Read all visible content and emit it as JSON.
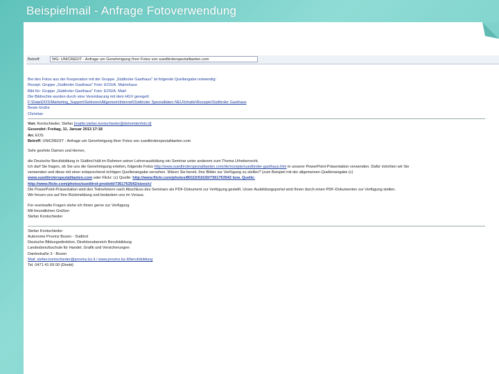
{
  "slide_title": "Beispielmail - Anfrage Fotoverwendung",
  "mail": {
    "subject_label": "Betreff:",
    "subject_value": "WG: UNICREDIT - Anfrage um Genehmigung Ihrer Fotos von suedtirolerspezialitaeten.com",
    "intro_lines": [
      "Bei den Fotos aus der Kooperation mit der Gruppe „Südtiroler Gasthaus\" ist folgende Quellangabe notwendig:",
      "Rezept: Gruppe „Südtiroler Gasthaus\" Foto: EOS/A. Mairinhaus",
      "Bild für: Gruppe „Südtiroler Gasthaus\" Foto: EOS/A. Mairl",
      "Die Bildrechte wurden durch eine Vereinbarung mit dem HGV geregelt:"
    ],
    "path_line": "F:\\Data\\DOS\\Marketing_Support\\Sektoren\\Allgemein\\Internet\\Südtiroler Spezialitäten NEU\\Inhalte\\Rezepte\\Südtiroler Gasthaus",
    "greeting": "Beste Grüße",
    "sender_first": "Christian",
    "header_fields": [
      {
        "label": "Von:",
        "value": "Kontschieder, Stefan",
        "link": "[mailto:stefan.kontschieder@dolomitenfoto.it]"
      },
      {
        "label": "Gesendet:",
        "value": "Freitag, 11. Januar 2013 17:18",
        "link": ""
      },
      {
        "label": "An:",
        "value": "EOS",
        "link": ""
      },
      {
        "label": "Betreff:",
        "value": "UNICREDIT - Anfrage um Genehmigung Ihrer Fotos von suedtirolerspezialitaeten.com",
        "link": ""
      }
    ],
    "salutation": "Sehr geehrte Damen und Herren,",
    "paragraph_lines": [
      "die Deutsche Berufsbildung in Südtirol hält im Rahmen seiner Lehrerausbildung ein Seminar unter anderem zum Thema Urheberrecht.",
      "Ich darf Sie fragen, ob Sie uns die Genehmigung erteilen, folgende Fotos",
      "verwenden und diese mit einer entsprechend richtigen Quellenangabe versehen. Wären Sie bereit, Ihre Bilder zur Verfügung zu stellen? (zum Beispiel mit der allgemeinen Quellenangabe (c)"
    ],
    "paragraph_link_1": "http://www.suedtirolerspezialitaeten.com/de/rezepte/suedtiroler-gasthaus.htm",
    "paragraph_tail_1": "in unserer PowerPoint-Präsentation verwenden. Dafür möchten wir Sie",
    "url_line_1": "www.suedtirolerspezialitaeten.com",
    "url_tail_1": "oder Flickr: (c) Quelle:",
    "url_line_2": "http://www.flickr.com/photos/80115/51630/7361763542 bzw. Quelle:",
    "url_line_3": "http://www.flickr.com/photos/suedtirol-prodotti/7361763542/sizes/c/",
    "closing_paragraph": "Die PowerPoint-Präsentation wird den Teilnehmern nach Abschluss des Seminars als PDF-Dokument zur Verfügung gestellt. Unser Ausbildungsportal wird Ihnen durch einen PDF-Dokumenten zur Verfügung stellen.",
    "closing_paragraph_2": "Wir freuen uns auf Ihre Rückmeldung und bedanken uns im Voraus.",
    "questions": "Für eventuelle Fragen stehe ich Ihnen gerne zur Verfügung",
    "regards": "Mit freundlichen Grüßen",
    "signature_name": "Stefan Kontschieder",
    "signature_block": [
      "Stefan Kontschieder",
      "Autonome Provinz Bozen - Südtirol",
      "Deutsche Bildungsdirektion, Direktionsbereich Berufsbildung",
      "Landesberufsschule für Handel, Grafik und Versicherungen",
      "Dantestraße 3 - Bozen"
    ],
    "signature_link": "Mail: stefan.kontschieder@provinz.bz.it / www.provinz.bz.it/berufsbildung",
    "signature_phone": "Tel. 0471 41 69 00 (Direkt)"
  }
}
